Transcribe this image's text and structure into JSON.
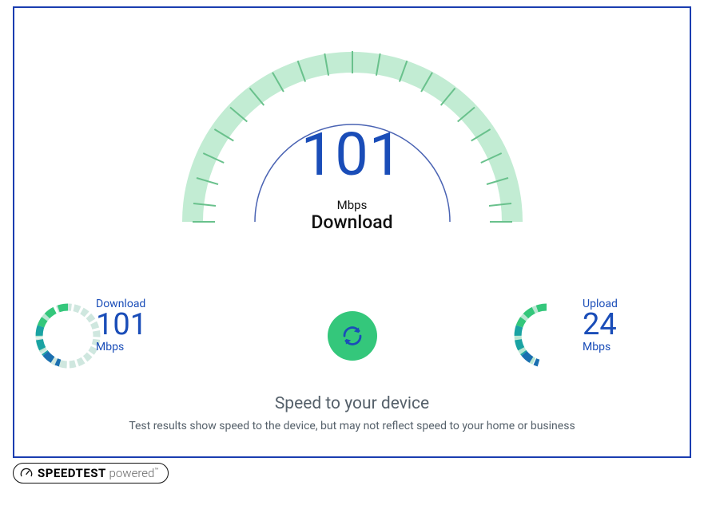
{
  "main": {
    "value": "101",
    "unit": "Mbps",
    "label": "Download"
  },
  "download": {
    "label": "Download",
    "value": "101",
    "unit": "Mbps"
  },
  "upload": {
    "label": "Upload",
    "value": "24",
    "unit": "Mbps"
  },
  "footer": {
    "title": "Speed to your device",
    "subtitle": "Test results show speed to the device, but may not reflect speed to your home or business"
  },
  "brand": {
    "name": "SPEEDTEST",
    "suffix": "powered"
  },
  "colors": {
    "primary_blue": "#1a4db8",
    "border_blue": "#1a3db0",
    "gauge_light": "#c2ecd3",
    "gauge_tick": "#69c18c",
    "green": "#34c77b",
    "arc_inner": "#4a63b3",
    "teal": "#1aa3a3"
  },
  "chart_data": {
    "type": "gauge",
    "main_value": 101,
    "unit": "Mbps",
    "download": 101,
    "upload": 24
  }
}
